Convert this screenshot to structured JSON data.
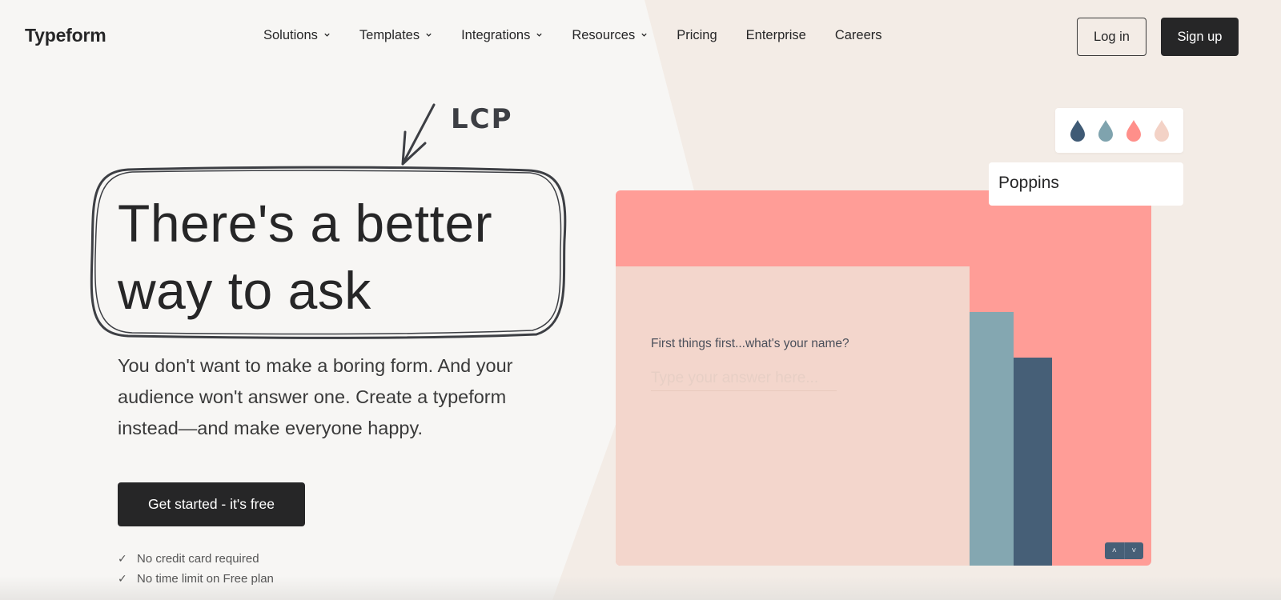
{
  "header": {
    "logo": "Typeform",
    "nav": [
      {
        "label": "Solutions",
        "has_dropdown": true
      },
      {
        "label": "Templates",
        "has_dropdown": true
      },
      {
        "label": "Integrations",
        "has_dropdown": true
      },
      {
        "label": "Resources",
        "has_dropdown": true
      },
      {
        "label": "Pricing",
        "has_dropdown": false
      },
      {
        "label": "Enterprise",
        "has_dropdown": false
      },
      {
        "label": "Careers",
        "has_dropdown": false
      }
    ],
    "login_label": "Log in",
    "signup_label": "Sign up"
  },
  "annotation": {
    "label": "LCP"
  },
  "hero": {
    "title_line1": "There's a better",
    "title_line2": "way to ask",
    "description": "You don't want to make a boring form. And your audience won't answer one. Create a typeform instead—and make everyone happy.",
    "cta_label": "Get started - it's free",
    "checks": [
      "No credit card required",
      "No time limit on Free plan"
    ]
  },
  "illustration": {
    "palette_colors": [
      "#3f5a75",
      "#7fa3ae",
      "#ff8f8a",
      "#f3d2c6"
    ],
    "font_name": "Poppins",
    "question": "First things first...what's your name?",
    "answer_placeholder": "Type your answer here...",
    "colors": {
      "canvas": "#ff9d97",
      "panel": "#f3d6cc",
      "bar_light": "#84a7b1",
      "bar_dark": "#465f77"
    }
  }
}
